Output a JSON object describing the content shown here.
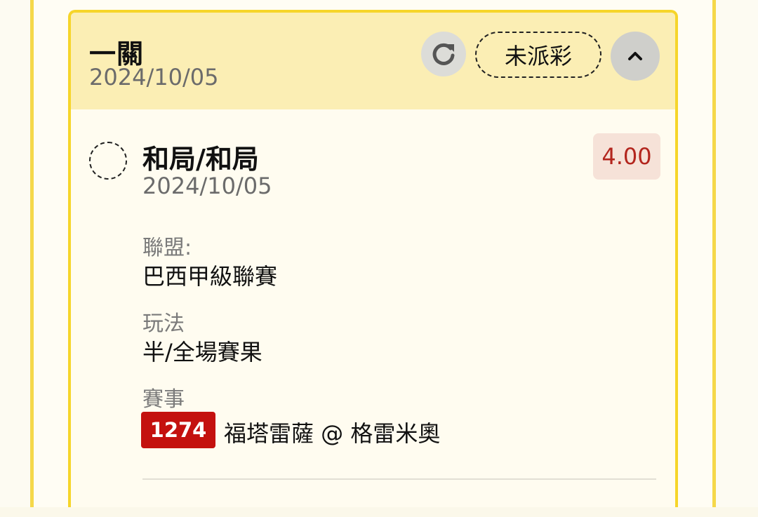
{
  "header": {
    "title": "一關",
    "date": "2024/10/05",
    "status_label": "未派彩"
  },
  "icons": {
    "refresh": "refresh-icon",
    "collapse": "chevron-up-icon",
    "select": "dashed-circle-icon"
  },
  "selection": {
    "title": "和局/和局",
    "date": "2024/10/05",
    "odds": "4.00"
  },
  "fields": {
    "league_label": "聯盟:",
    "league_value": "巴西甲級聯賽",
    "bet_type_label": "玩法",
    "bet_type_value": "半/全場賽果",
    "match_label": "賽事",
    "match_code": "1274",
    "match_name": "福塔雷薩 @ 格雷米奧"
  },
  "colors": {
    "accent_yellow": "#f6d52a",
    "header_bg": "#fbeeb4",
    "odds_text": "#b3261e",
    "odds_bg": "#f6e2d8",
    "match_code_bg": "#c4110f"
  }
}
